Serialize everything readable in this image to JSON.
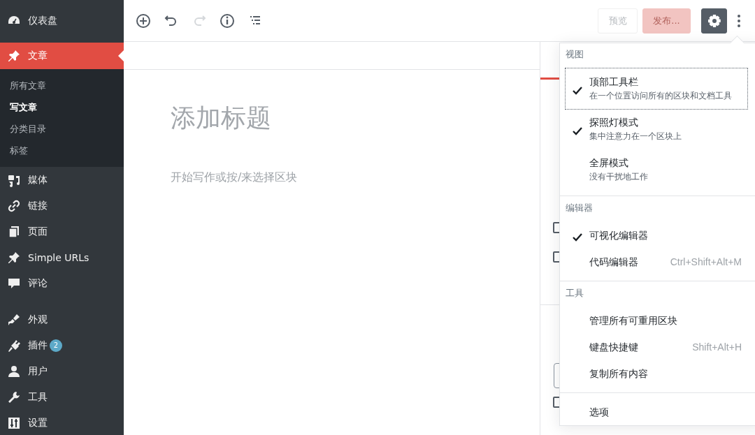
{
  "admin_menu": [
    {
      "label": "仪表盘",
      "selected": false
    },
    {
      "label": "文章",
      "selected": true,
      "submenu": [
        {
          "label": "所有文章",
          "selected": false
        },
        {
          "label": "写文章",
          "selected": true
        },
        {
          "label": "分类目录",
          "selected": false
        },
        {
          "label": "标签",
          "selected": false
        }
      ]
    },
    {
      "label": "媒体",
      "selected": false
    },
    {
      "label": "链接",
      "selected": false
    },
    {
      "label": "页面",
      "selected": false
    },
    {
      "label": "Simple URLs",
      "selected": false
    },
    {
      "label": "评论",
      "selected": false
    },
    {
      "label": "外观",
      "selected": false,
      "gap_before": true
    },
    {
      "label": "插件",
      "selected": false,
      "badge": "2"
    },
    {
      "label": "用户",
      "selected": false
    },
    {
      "label": "工具",
      "selected": false
    },
    {
      "label": "设置",
      "selected": false
    }
  ],
  "toolbar": {
    "redo_disabled": true,
    "preview": {
      "label": "预览",
      "disabled": true
    },
    "publish": {
      "label": "发布...",
      "disabled": true
    },
    "settings_pressed": true
  },
  "settings_panel": {
    "checkboxes": [
      {
        "checked": false
      },
      {
        "checked": false
      },
      {
        "checked": false
      }
    ]
  },
  "editor": {
    "title_placeholder": "添加标题",
    "body_placeholder": "开始写作或按/来选择区块"
  },
  "more_menu": {
    "sections": [
      {
        "title": "视图",
        "items": [
          {
            "label": "顶部工具栏",
            "description": "在一个位置访问所有的区块和文档工具",
            "checked": true,
            "focused": true
          },
          {
            "label": "探照灯模式",
            "description": "集中注意力在一个区块上",
            "checked": true,
            "focused": false
          },
          {
            "label": "全屏模式",
            "description": "没有干扰地工作",
            "checked": false,
            "focused": false
          }
        ]
      },
      {
        "title": "编辑器",
        "items": [
          {
            "label": "可视化编辑器",
            "checked": true,
            "focused": false
          },
          {
            "label": "代码编辑器",
            "shortcut": "Ctrl+Shift+Alt+M",
            "checked": false,
            "focused": false
          }
        ]
      },
      {
        "title": "工具",
        "items": [
          {
            "label": "管理所有可重用区块",
            "checked": false,
            "focused": false
          },
          {
            "label": "键盘快捷键",
            "shortcut": "Shift+Alt+H",
            "checked": false,
            "focused": false
          },
          {
            "label": "复制所有内容",
            "checked": false,
            "focused": false
          }
        ]
      },
      {
        "items": [
          {
            "label": "选项",
            "checked": false,
            "focused": false
          }
        ]
      }
    ]
  }
}
